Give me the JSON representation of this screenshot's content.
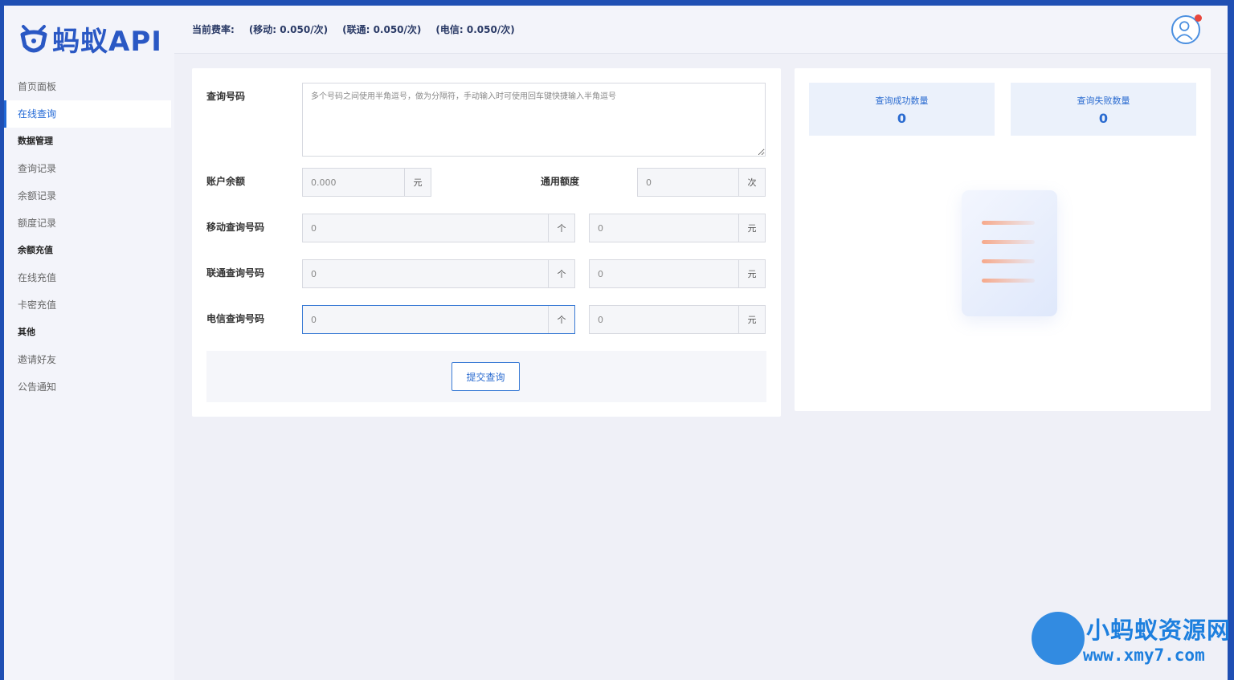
{
  "brand": {
    "name": "蚂蚁API"
  },
  "header": {
    "rate_label": "当前费率:",
    "mobile_rate": "(移动: 0.050/次)",
    "unicom_rate": "(联通: 0.050/次)",
    "telecom_rate": "(电信: 0.050/次)"
  },
  "sidebar": {
    "items": [
      {
        "label": "首页面板",
        "type": "item"
      },
      {
        "label": "在线查询",
        "type": "item",
        "active": true
      },
      {
        "label": "数据管理",
        "type": "group"
      },
      {
        "label": "查询记录",
        "type": "item"
      },
      {
        "label": "余额记录",
        "type": "item"
      },
      {
        "label": "额度记录",
        "type": "item"
      },
      {
        "label": "余额充值",
        "type": "group"
      },
      {
        "label": "在线充值",
        "type": "item"
      },
      {
        "label": "卡密充值",
        "type": "item"
      },
      {
        "label": "其他",
        "type": "group"
      },
      {
        "label": "邀请好友",
        "type": "item"
      },
      {
        "label": "公告通知",
        "type": "item"
      }
    ]
  },
  "form": {
    "numbers_label": "查询号码",
    "numbers_placeholder": "多个号码之间使用半角逗号，做为分隔符，手动输入时可使用回车键快捷输入半角逗号",
    "balance_label": "账户余额",
    "balance_value": "0.000",
    "balance_unit": "元",
    "quota_label": "通用额度",
    "quota_value": "0",
    "quota_unit": "次",
    "mobile_label": "移动查询号码",
    "mobile_count": "0",
    "mobile_count_unit": "个",
    "mobile_cost": "0",
    "mobile_cost_unit": "元",
    "unicom_label": "联通查询号码",
    "unicom_count": "0",
    "unicom_count_unit": "个",
    "unicom_cost": "0",
    "unicom_cost_unit": "元",
    "telecom_label": "电信查询号码",
    "telecom_count": "0",
    "telecom_count_unit": "个",
    "telecom_cost": "0",
    "telecom_cost_unit": "元",
    "submit_label": "提交查询"
  },
  "stats": {
    "success_label": "查询成功数量",
    "success_value": "0",
    "fail_label": "查询失败数量",
    "fail_value": "0"
  },
  "watermark": {
    "title": "小蚂蚁资源网",
    "url": "www.xmy7.com"
  },
  "colors": {
    "accent": "#1f67d6",
    "frame": "#1f4fb3",
    "notification": "#e8463c"
  },
  "icons": [
    "ant-logo-icon",
    "user-avatar-icon",
    "document-empty-icon"
  ]
}
